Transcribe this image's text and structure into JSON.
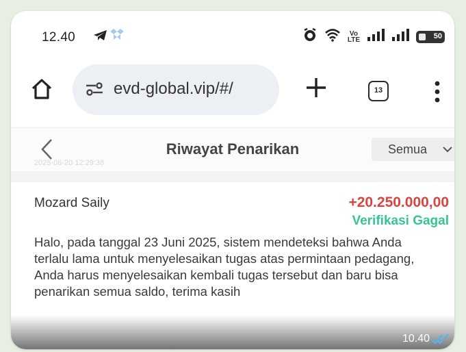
{
  "status_bar": {
    "time": "12.40",
    "network_label": "Vo\nLTE",
    "battery_level": "50"
  },
  "browser": {
    "url": "evd-global.vip/#/",
    "tab_count": "13"
  },
  "page": {
    "title": "Riwayat Penarikan",
    "filter_value": "Semua"
  },
  "withdrawal": {
    "name": "Mozard Saily",
    "amount": "+20.250.000,00",
    "status": "Verifikasi Gagal",
    "status_color": "#36c494",
    "amount_color": "#d9443f",
    "message": "Halo, pada tanggal 23 Juni 2025, sistem mendeteksi bahwa Anda terlalu lama untuk menyelesaikan tugas atas permintaan pedagang, Anda harus menyelesaikan kembali tugas tersebut dan baru bisa penarikan semua saldo, terima kasih",
    "timestamp": "2025-06-20 12:29:38"
  },
  "chat": {
    "time": "10.40",
    "tick_color": "#4fb6ec"
  }
}
